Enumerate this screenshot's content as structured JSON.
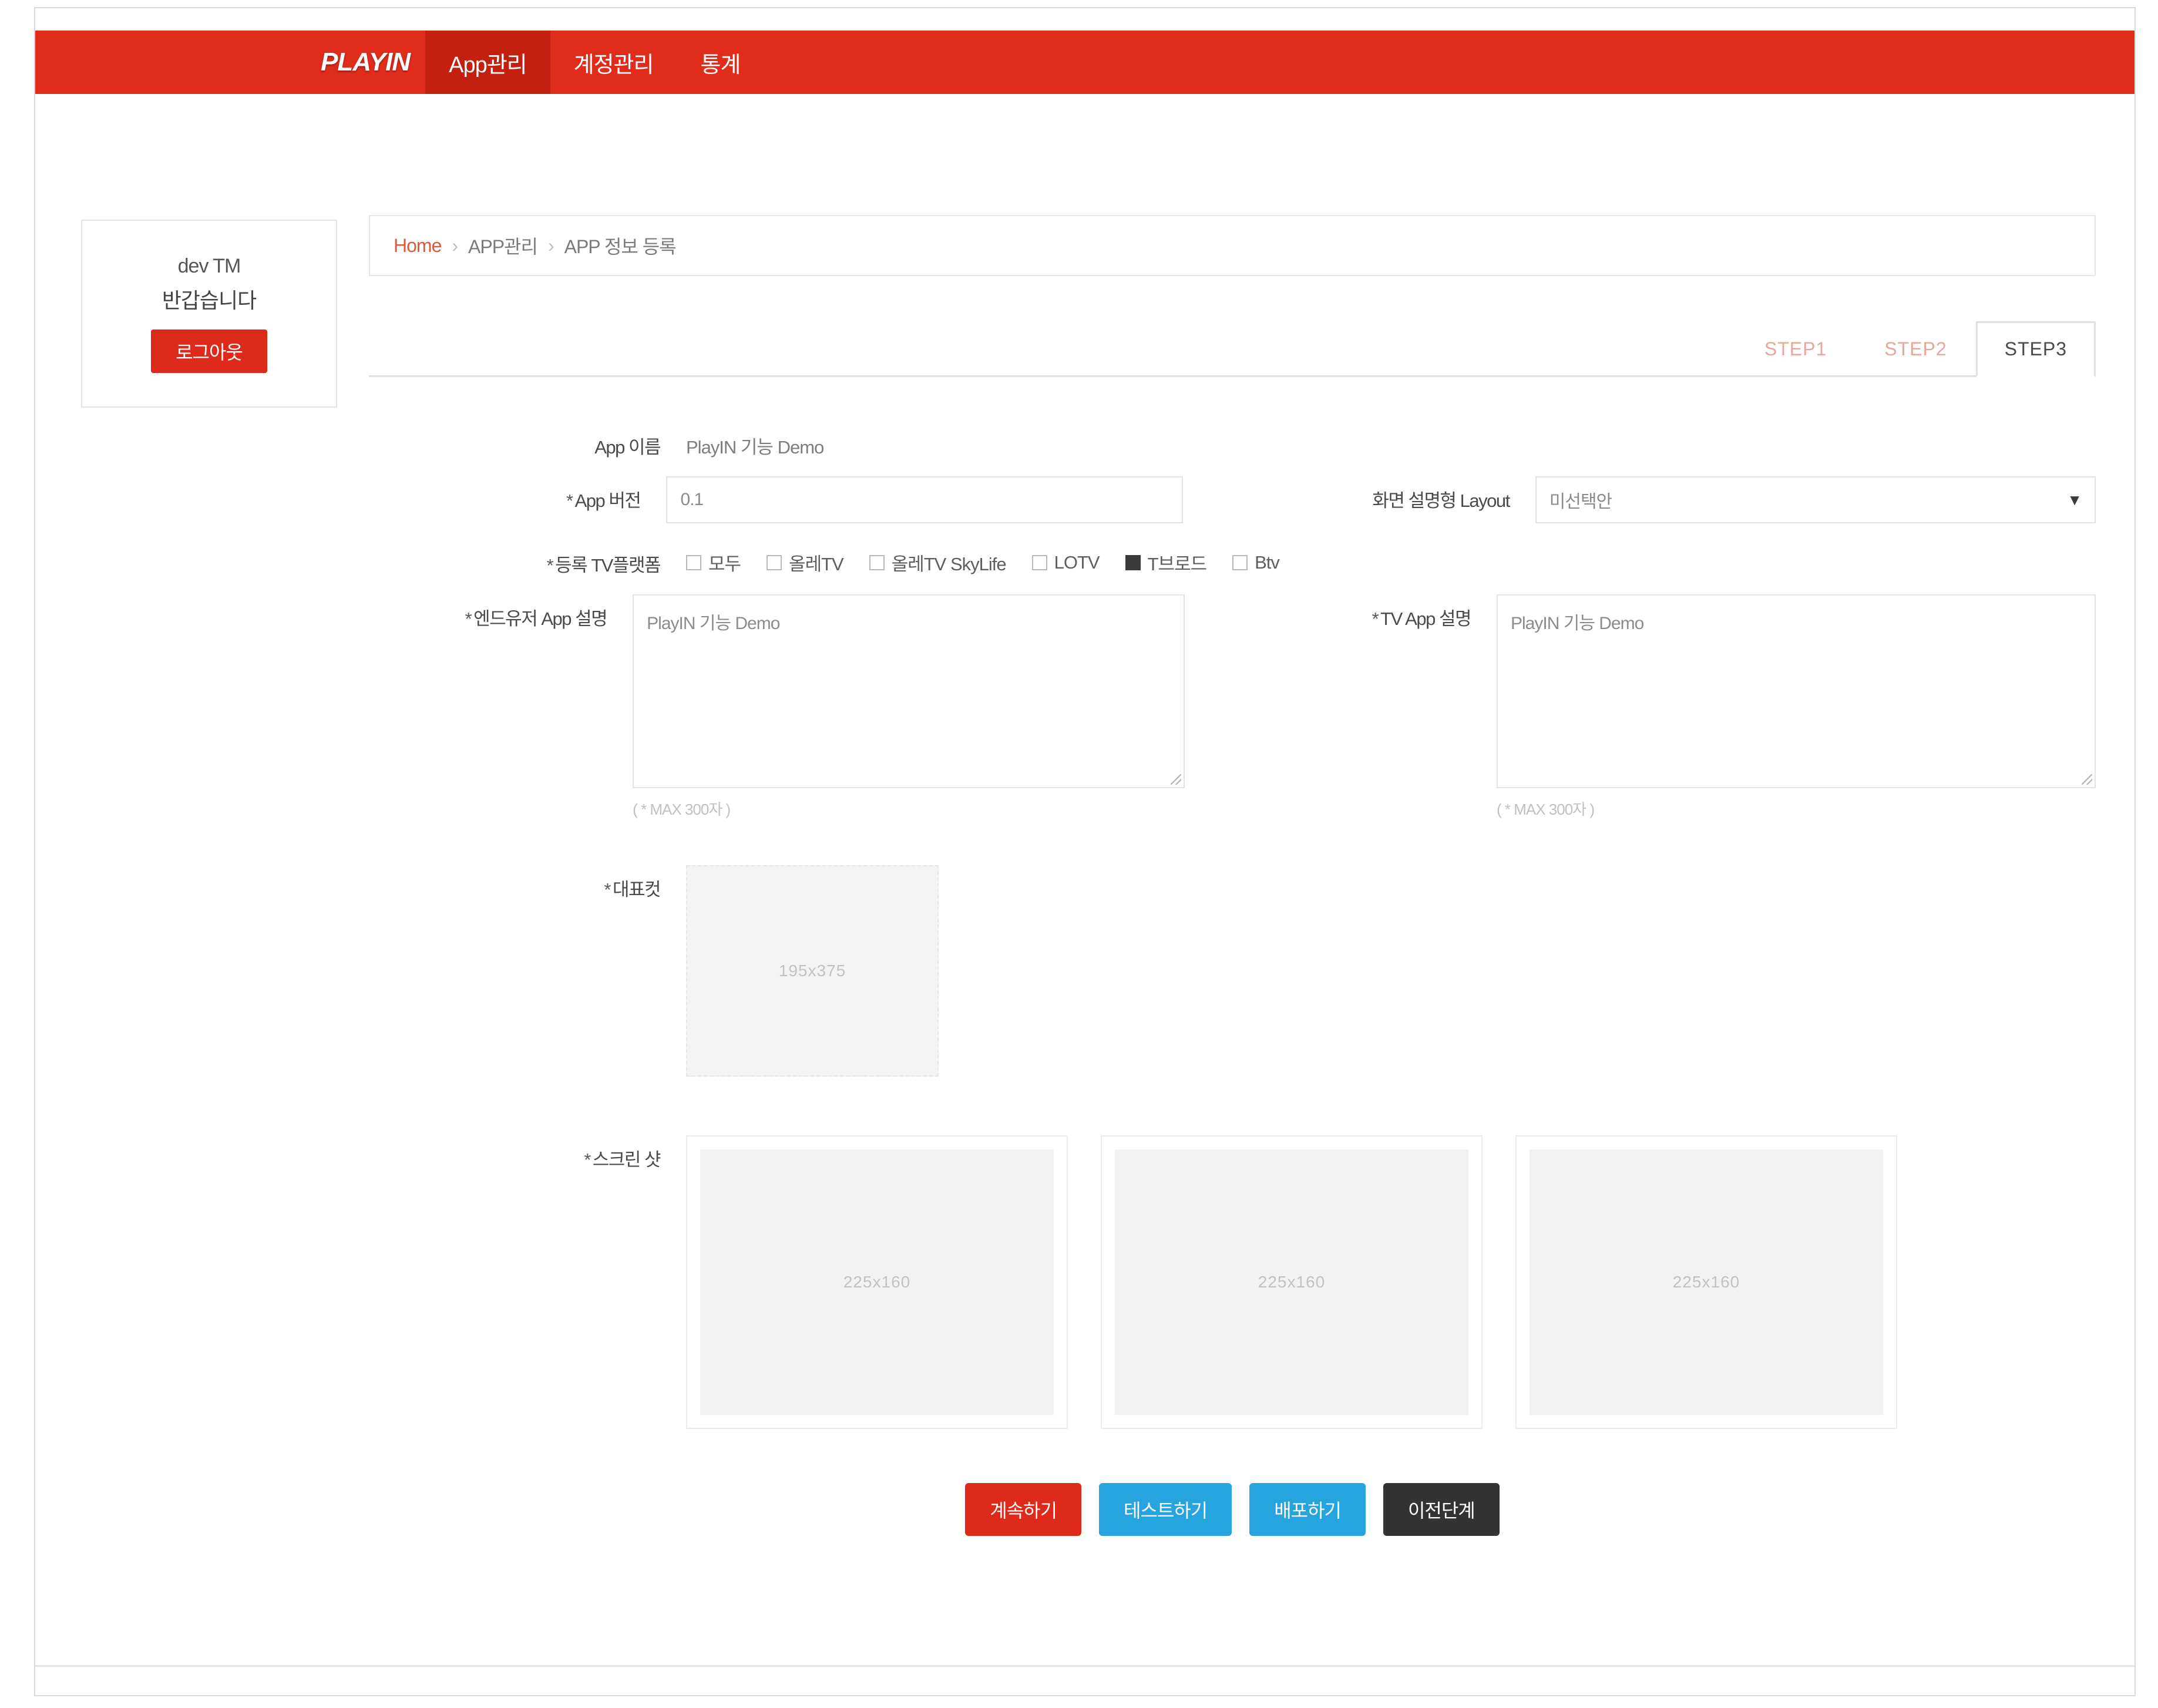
{
  "topnav": {
    "brand": "PLAYIN",
    "items": [
      {
        "label": "App관리",
        "active": true
      },
      {
        "label": "계정관리",
        "active": false
      },
      {
        "label": "통계",
        "active": false
      }
    ]
  },
  "sidebar": {
    "user": "dev TM",
    "greeting": "반갑습니다",
    "logout_label": "로그아웃"
  },
  "breadcrumb": {
    "home": "Home",
    "sep1": "›",
    "level2": "APP관리",
    "sep2": "›",
    "level3": "APP 정보 등록"
  },
  "steps": [
    {
      "label": "STEP1",
      "active": false
    },
    {
      "label": "STEP2",
      "active": false
    },
    {
      "label": "STEP3",
      "active": true
    }
  ],
  "form": {
    "app_name_label": "App 이름",
    "app_name_value": "PlayIN 기능 Demo",
    "app_version_label": "App 버전",
    "app_version_value": "0.1",
    "layout_label": "화면 설명형 Layout",
    "layout_value": "미선택안",
    "tv_label": "등록 TV플랫폼",
    "tv_options": [
      {
        "label": "모두",
        "checked": false
      },
      {
        "label": "올레TV",
        "checked": false
      },
      {
        "label": "올레TV SkyLife",
        "checked": false
      },
      {
        "label": "LOTV",
        "checked": false
      },
      {
        "label": "T브로드",
        "checked": true
      },
      {
        "label": "Btv",
        "checked": false
      }
    ],
    "enduser_desc_label": "엔드유저 App 설명",
    "enduser_desc_value": "PlayIN 기능 Demo",
    "enduser_desc_hint": "( * MAX 300자 )",
    "tv_desc_label": "TV App 설명",
    "tv_desc_value": "PlayIN 기능 Demo",
    "tv_desc_hint": "( * MAX 300자 )",
    "thumb_label": "대표컷",
    "thumb_size": "195x375",
    "screenshot_label": "스크린 샷",
    "screenshot_sizes": [
      "225x160",
      "225x160",
      "225x160"
    ]
  },
  "buttons": [
    {
      "label": "계속하기",
      "style": "red"
    },
    {
      "label": "테스트하기",
      "style": "blue"
    },
    {
      "label": "배포하기",
      "style": "blue"
    },
    {
      "label": "이전단계",
      "style": "dark"
    }
  ],
  "colors": {
    "brand_red": "#e02d1b",
    "button_red": "#dd2a1b",
    "button_blue": "#27a3dd",
    "button_dark": "#333333"
  }
}
